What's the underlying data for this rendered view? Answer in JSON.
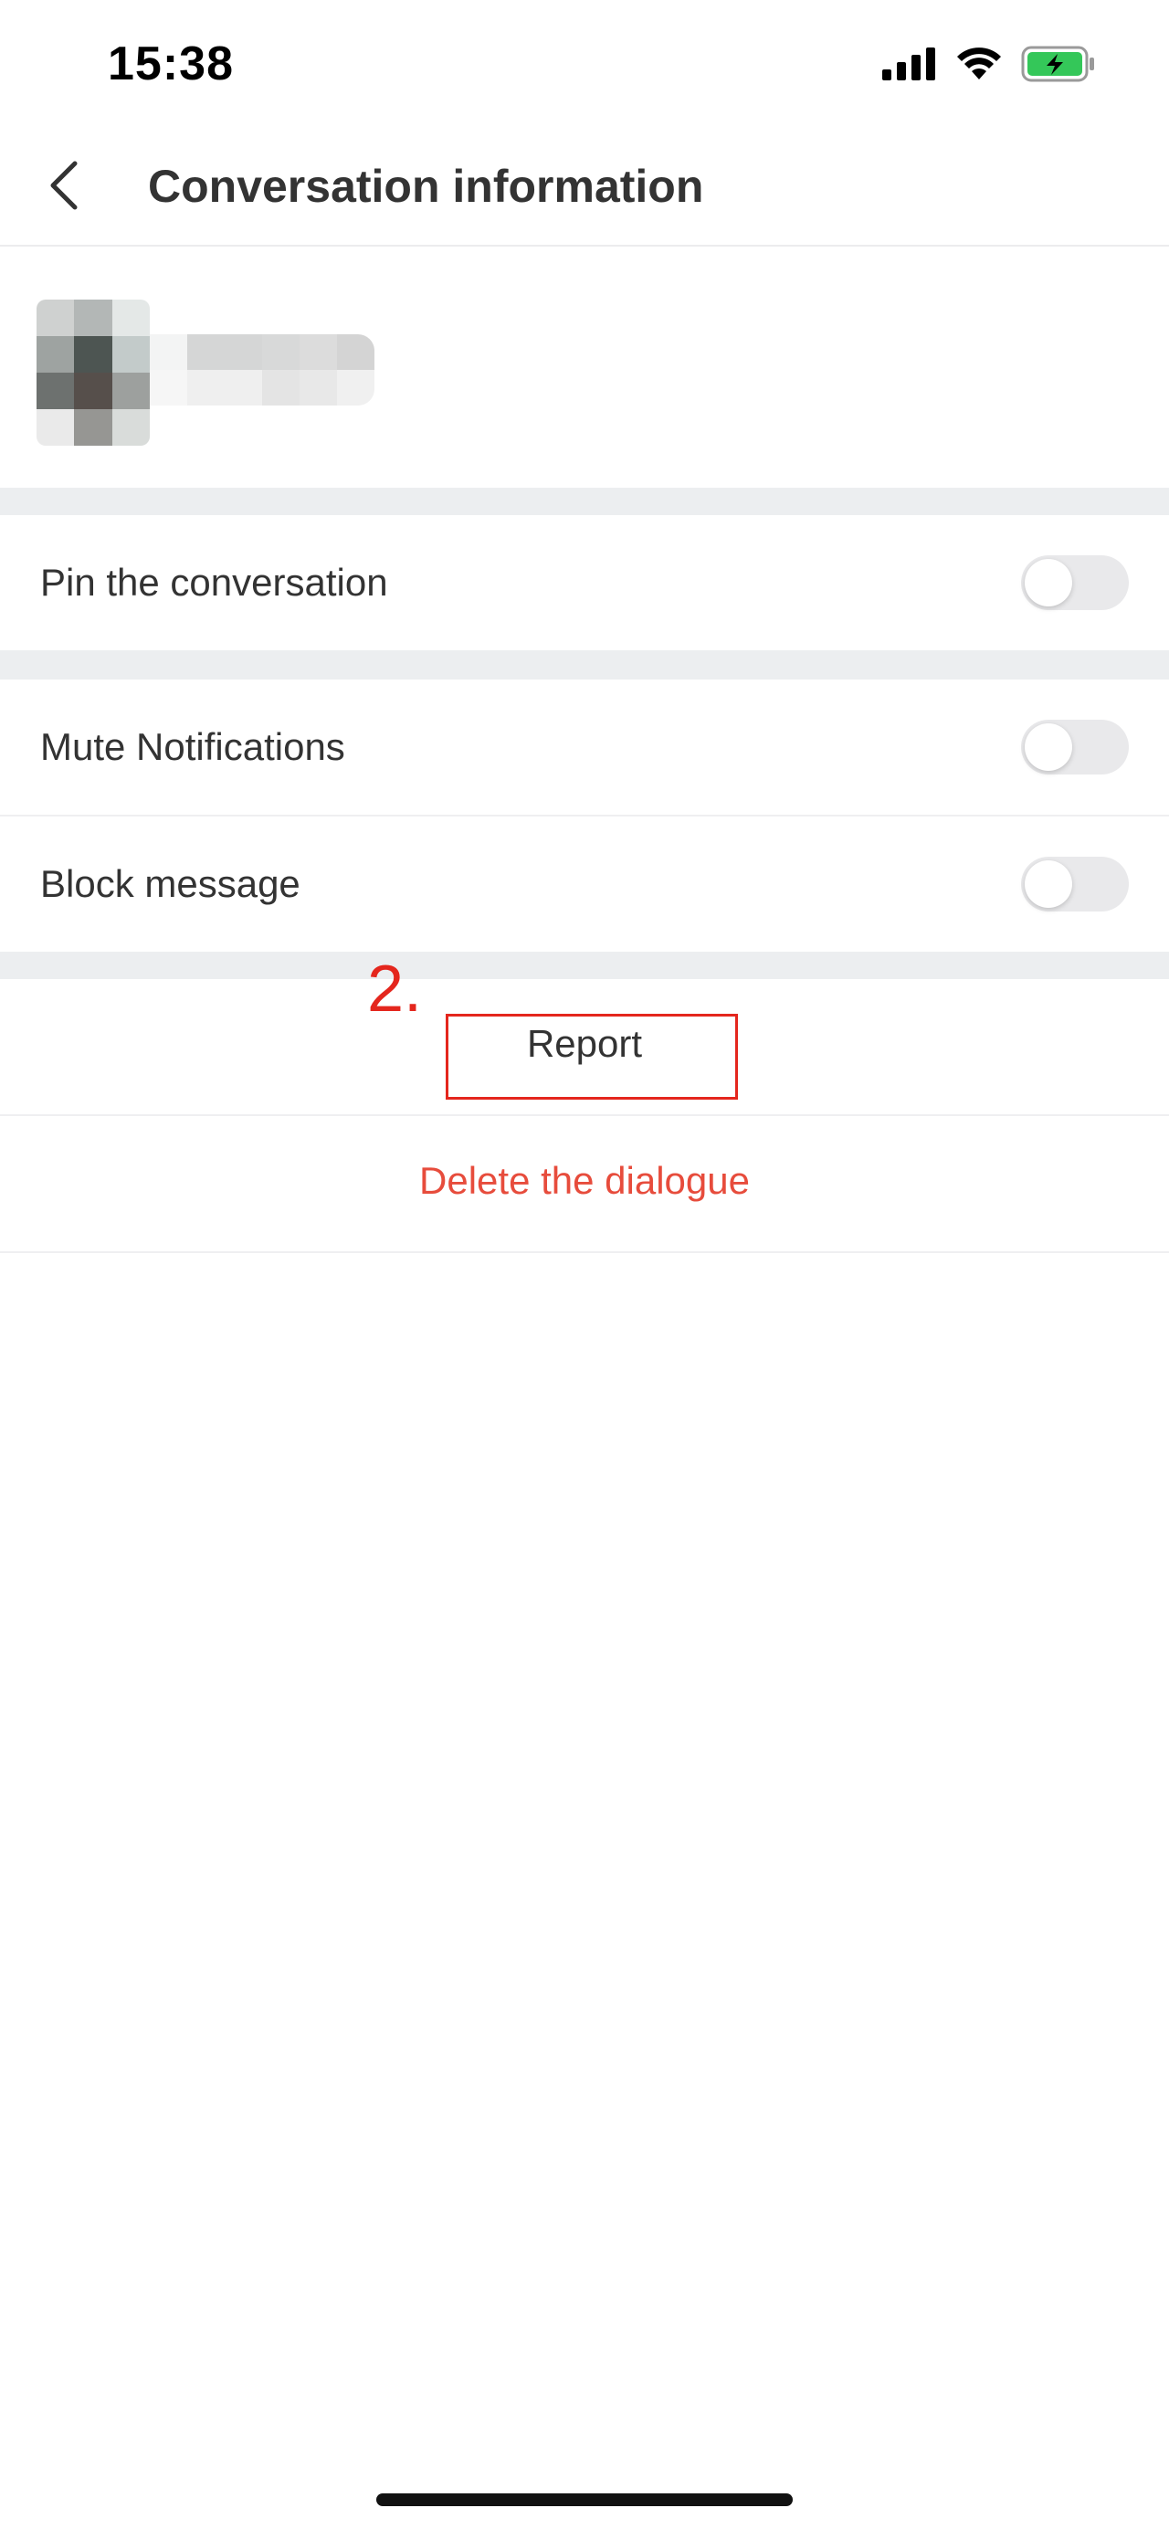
{
  "status_bar": {
    "time": "15:38",
    "icons": [
      "cellular-signal-icon",
      "wifi-icon",
      "battery-charging-icon"
    ],
    "battery_color": "#34c759"
  },
  "nav": {
    "back_icon": "chevron-left-icon",
    "title": "Conversation information"
  },
  "settings": {
    "pin": {
      "label": "Pin the conversation",
      "enabled": false
    },
    "mute": {
      "label": "Mute Notifications",
      "enabled": false
    },
    "block": {
      "label": "Block message",
      "enabled": false
    }
  },
  "actions": {
    "report": "Report",
    "delete": "Delete the dialogue",
    "delete_color": "#e74c3c"
  },
  "annotation": {
    "number": "2.",
    "color": "#e4261d"
  }
}
